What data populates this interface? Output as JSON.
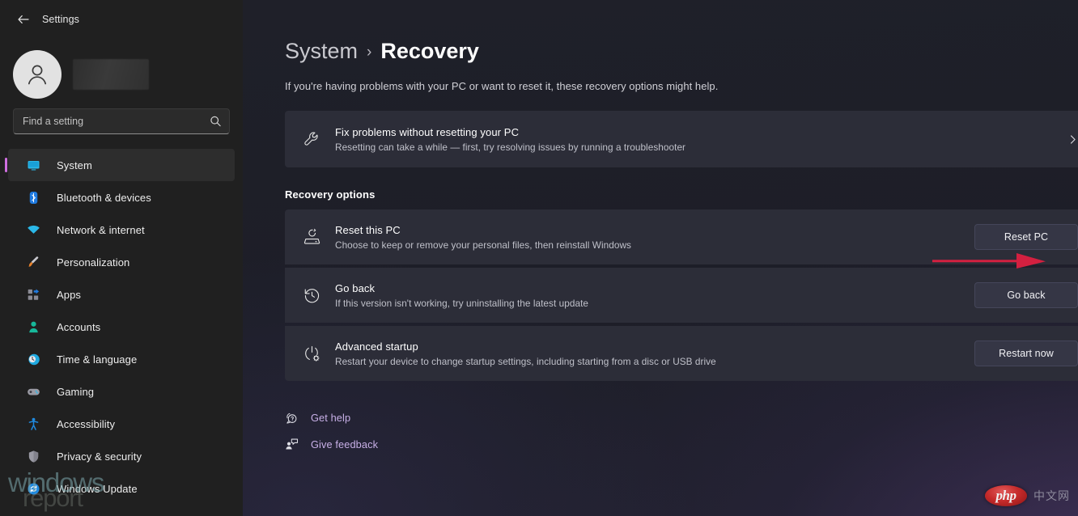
{
  "window": {
    "title": "Settings",
    "back_icon": "back-arrow-icon"
  },
  "sidebar": {
    "account": {
      "name_redacted": "",
      "avatar_icon": "person-avatar-icon"
    },
    "search": {
      "placeholder": "Find a setting",
      "value": "",
      "icon": "search-icon"
    },
    "items": [
      {
        "label": "System",
        "icon": "monitor-icon",
        "selected": true
      },
      {
        "label": "Bluetooth & devices",
        "icon": "bluetooth-icon",
        "selected": false
      },
      {
        "label": "Network & internet",
        "icon": "wifi-icon",
        "selected": false
      },
      {
        "label": "Personalization",
        "icon": "paintbrush-icon",
        "selected": false
      },
      {
        "label": "Apps",
        "icon": "apps-grid-icon",
        "selected": false
      },
      {
        "label": "Accounts",
        "icon": "person-icon",
        "selected": false
      },
      {
        "label": "Time & language",
        "icon": "clock-icon",
        "selected": false
      },
      {
        "label": "Gaming",
        "icon": "gamepad-icon",
        "selected": false
      },
      {
        "label": "Accessibility",
        "icon": "accessibility-icon",
        "selected": false
      },
      {
        "label": "Privacy & security",
        "icon": "shield-icon",
        "selected": false
      },
      {
        "label": "Windows Update",
        "icon": "update-refresh-icon",
        "selected": false
      }
    ]
  },
  "main": {
    "breadcrumb": {
      "parent": "System",
      "separator": "›",
      "current": "Recovery"
    },
    "subtitle": "If you're having problems with your PC or want to reset it, these recovery options might help.",
    "troubleshoot_card": {
      "icon": "wrench-icon",
      "title": "Fix problems without resetting your PC",
      "subtitle": "Resetting can take a while — first, try resolving issues by running a troubleshooter",
      "chevron_icon": "chevron-right-icon"
    },
    "section_heading": "Recovery options",
    "options": [
      {
        "icon": "reset-pc-icon",
        "title": "Reset this PC",
        "subtitle": "Choose to keep or remove your personal files, then reinstall Windows",
        "button": "Reset PC"
      },
      {
        "icon": "history-clock-icon",
        "title": "Go back",
        "subtitle": "If this version isn't working, try uninstalling the latest update",
        "button": "Go back"
      },
      {
        "icon": "power-gear-icon",
        "title": "Advanced startup",
        "subtitle": "Restart your device to change startup settings, including starting from a disc or USB drive",
        "button": "Restart now"
      }
    ],
    "links": [
      {
        "label": "Get help",
        "icon": "help-question-icon"
      },
      {
        "label": "Give feedback",
        "icon": "feedback-person-icon"
      }
    ]
  },
  "annotations": {
    "arrow": {
      "color": "#d32040",
      "points_to": "Reset PC",
      "direction": "right"
    }
  },
  "watermarks": {
    "windows_report": {
      "line1": "windows",
      "line2": "report"
    },
    "php": {
      "badge": "php",
      "suffix": "中文网"
    }
  },
  "colors": {
    "accent_selection": "#cf6fe0",
    "link": "#c7afe6",
    "card_bg": "#2c2d38",
    "page_bg": "#1e1f29",
    "sidebar_bg": "#202020",
    "annotation_red": "#d32040"
  }
}
